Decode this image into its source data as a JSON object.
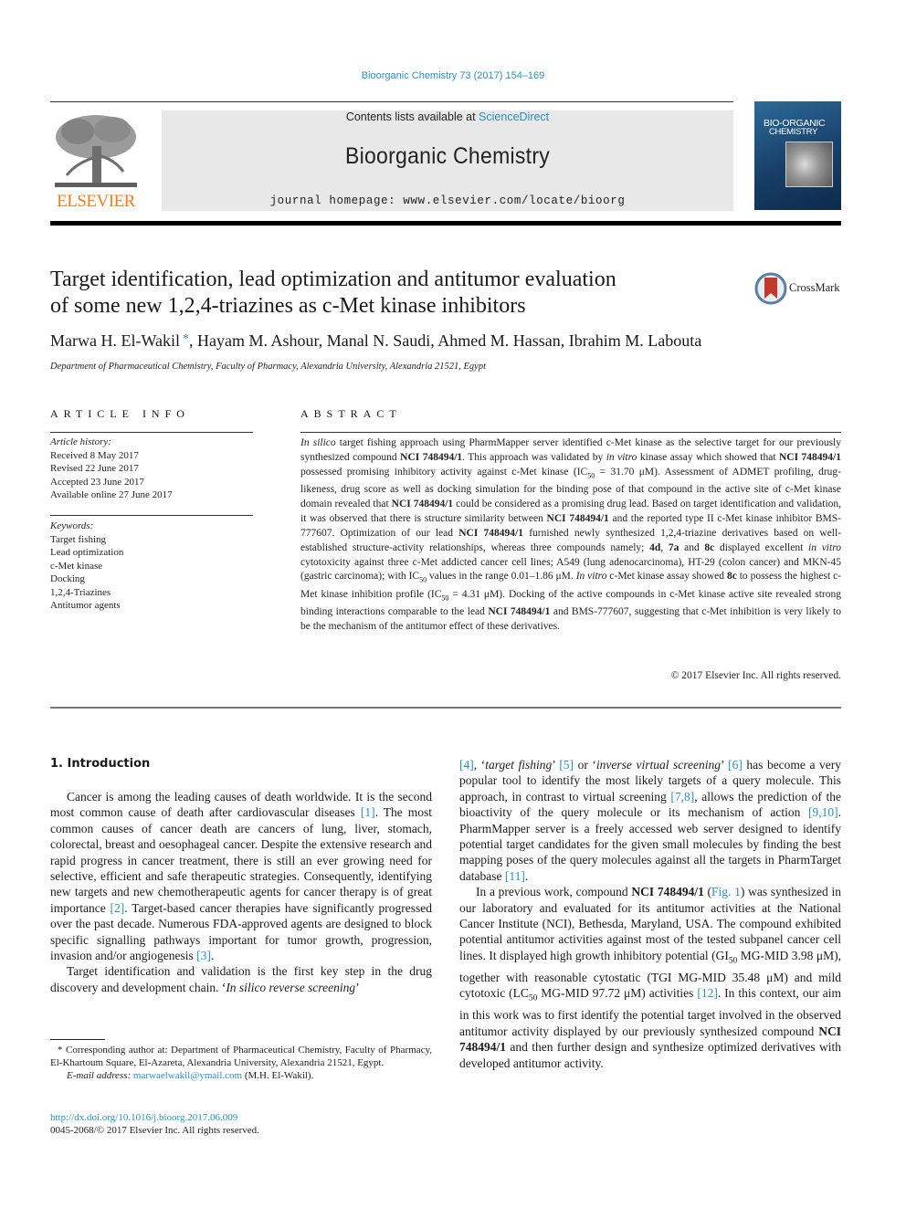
{
  "citation": "Bioorganic Chemistry 73 (2017) 154–169",
  "banner": {
    "contents_prefix": "Contents lists available at ",
    "contents_link": "ScienceDirect",
    "journal_title": "Bioorganic Chemistry",
    "homepage": "journal homepage: www.elsevier.com/locate/bioorg"
  },
  "publisher_logo": {
    "icon": "elsevier-tree-icon",
    "label": "ELSEVIER",
    "color": "#f07d1a"
  },
  "cover": {
    "title_line1": "BIO-ORGANIC",
    "title_line2": "CHEMISTRY"
  },
  "crossmark": {
    "icon": "crossmark-icon",
    "label": "CrossMark"
  },
  "article": {
    "title_line1": "Target identification, lead optimization and antitumor evaluation",
    "title_line2": "of some new 1,2,4-triazines as c-Met kinase inhibitors",
    "authors": [
      {
        "name": "Marwa H. El-Wakil",
        "mark": "*"
      },
      {
        "name": "Hayam M. Ashour"
      },
      {
        "name": "Manal N. Saudi"
      },
      {
        "name": "Ahmed M. Hassan"
      },
      {
        "name": "Ibrahim M. Labouta"
      }
    ],
    "affiliation": "Department of Pharmaceutical Chemistry, Faculty of Pharmacy, Alexandria University, Alexandria 21521, Egypt"
  },
  "article_info": {
    "heading": "ARTICLE INFO",
    "history_label": "Article history:",
    "history": [
      "Received 8 May 2017",
      "Revised 22 June 2017",
      "Accepted 23 June 2017",
      "Available online 27 June 2017"
    ],
    "keywords_label": "Keywords:",
    "keywords": [
      "Target fishing",
      "Lead optimization",
      "c-Met kinase",
      "Docking",
      "1,2,4-Triazines",
      "Antitumor agents"
    ]
  },
  "abstract": {
    "heading": "ABSTRACT",
    "copyright": "© 2017 Elsevier Inc. All rights reserved.",
    "segments": [
      {
        "t": "In silico",
        "s": "i"
      },
      {
        "t": " target fishing approach using PharmMapper server identified c-Met kinase as the selective target for our previously synthesized compound "
      },
      {
        "t": "NCI 748494/1",
        "s": "b"
      },
      {
        "t": ". This approach was validated by "
      },
      {
        "t": "in vitro",
        "s": "i"
      },
      {
        "t": " kinase assay which showed that "
      },
      {
        "t": "NCI 748494/1",
        "s": "b"
      },
      {
        "t": " possessed promising inhibitory activity against c-Met kinase (IC"
      },
      {
        "t": "50",
        "s": "sub"
      },
      {
        "t": " = 31.70 μM). Assessment of ADMET profiling, drug-likeness, drug score as well as docking simulation for the binding pose of that compound in the active site of c-Met kinase domain revealed that "
      },
      {
        "t": "NCI 748494/1",
        "s": "b"
      },
      {
        "t": " could be considered as a promising drug lead. Based on target identification and validation, it was observed that there is structure similarity between "
      },
      {
        "t": "NCI 748494/1",
        "s": "b"
      },
      {
        "t": " and the reported type II c-Met kinase inhibitor BMS-777607. Optimization of our lead "
      },
      {
        "t": "NCI 748494/1",
        "s": "b"
      },
      {
        "t": " furnished newly synthesized 1,2,4-triazine derivatives based on well-established structure-activity relationships, whereas three compounds namely; "
      },
      {
        "t": "4d",
        "s": "b"
      },
      {
        "t": ", "
      },
      {
        "t": "7a",
        "s": "b"
      },
      {
        "t": " and "
      },
      {
        "t": "8c",
        "s": "b"
      },
      {
        "t": " displayed excellent "
      },
      {
        "t": "in vitro",
        "s": "i"
      },
      {
        "t": " cytotoxicity against three c-Met addicted cancer cell lines; A549 (lung adenocarcinoma), HT-29 (colon cancer) and MKN-45 (gastric carcinoma); with IC"
      },
      {
        "t": "50",
        "s": "sub"
      },
      {
        "t": " values in the range 0.01–1.86 μM. "
      },
      {
        "t": "In vitro",
        "s": "i"
      },
      {
        "t": " c-Met kinase assay showed "
      },
      {
        "t": "8c",
        "s": "b"
      },
      {
        "t": " to possess the highest c-Met kinase inhibition profile (IC"
      },
      {
        "t": "50",
        "s": "sub"
      },
      {
        "t": " = 4.31 μM). Docking of the active compounds in c-Met kinase active site revealed strong binding interactions comparable to the lead "
      },
      {
        "t": "NCI 748494/1",
        "s": "b"
      },
      {
        "t": " and BMS-777607, suggesting that c-Met inhibition is very likely to be the mechanism of the antitumor effect of these derivatives."
      }
    ]
  },
  "introduction": {
    "heading": "1. Introduction",
    "left_paragraphs": [
      [
        {
          "t": "Cancer is among the leading causes of death worldwide. It is the second most common cause of death after cardiovascular diseases "
        },
        {
          "t": "[1]",
          "s": "link"
        },
        {
          "t": ". The most common causes of cancer death are cancers of lung, liver, stomach, colorectal, breast and oesophageal cancer. Despite the extensive research and rapid progress in cancer treatment, there is still an ever growing need for selective, efficient and safe therapeutic strategies. Consequently, identifying new targets and new chemotherapeutic agents for cancer therapy is of great importance "
        },
        {
          "t": "[2]",
          "s": "link"
        },
        {
          "t": ". Target-based cancer therapies have significantly progressed over the past decade. Numerous FDA-approved agents are designed to block specific signalling pathways important for tumor growth, progression, invasion and/or angiogenesis "
        },
        {
          "t": "[3]",
          "s": "link"
        },
        {
          "t": "."
        }
      ],
      [
        {
          "t": "Target identification and validation is the first key step in the drug discovery and development chain. ‘"
        },
        {
          "t": "In silico reverse screening",
          "s": "i"
        },
        {
          "t": "’"
        }
      ]
    ],
    "right_paragraphs": [
      [
        {
          "t": "[4]",
          "s": "link"
        },
        {
          "t": ", ‘"
        },
        {
          "t": "target fishing",
          "s": "i"
        },
        {
          "t": "’ "
        },
        {
          "t": "[5]",
          "s": "link"
        },
        {
          "t": " or ‘"
        },
        {
          "t": "inverse virtual screening",
          "s": "i"
        },
        {
          "t": "’ "
        },
        {
          "t": "[6]",
          "s": "link"
        },
        {
          "t": " has become a very popular tool to identify the most likely targets of a query molecule. This approach, in contrast to virtual screening "
        },
        {
          "t": "[7,8]",
          "s": "link"
        },
        {
          "t": ", allows the prediction of the bioactivity of the query molecule or its mechanism of action "
        },
        {
          "t": "[9,10]",
          "s": "link"
        },
        {
          "t": ". PharmMapper server is a freely accessed web server designed to identify potential target candidates for the given small molecules by finding the best mapping poses of the query molecules against all the targets in PharmTarget database "
        },
        {
          "t": "[11]",
          "s": "link"
        },
        {
          "t": "."
        }
      ],
      [
        {
          "t": "In a previous work, compound "
        },
        {
          "t": "NCI 748494/1",
          "s": "b"
        },
        {
          "t": " ("
        },
        {
          "t": "Fig. 1",
          "s": "link"
        },
        {
          "t": ") was synthesized in our laboratory and evaluated for its antitumor activities at the National Cancer Institute (NCI), Bethesda, Maryland, USA. The compound exhibited potential antitumor activities against most of the tested subpanel cancer cell lines. It displayed high growth inhibitory potential (GI"
        },
        {
          "t": "50",
          "s": "sub"
        },
        {
          "t": " MG-MID 3.98 μM), together with reasonable cytostatic (TGI MG-MID 35.48 μM) and mild cytotoxic (LC"
        },
        {
          "t": "50",
          "s": "sub"
        },
        {
          "t": " MG-MID 97.72 μM) activities "
        },
        {
          "t": "[12]",
          "s": "link"
        },
        {
          "t": ". In this context, our aim in this work was to first identify the potential target involved in the observed antitumor activity displayed by our previously synthesized compound "
        },
        {
          "t": "NCI 748494/1",
          "s": "b"
        },
        {
          "t": " and then further design and synthesize optimized derivatives with developed antitumor activity."
        }
      ]
    ]
  },
  "footnote": {
    "mark": "*",
    "text": "Corresponding author at: Department of Pharmaceutical Chemistry, Faculty of Pharmacy, El-Khartoum Square, El-Azareta, Alexandria University, Alexandria 21521, Egypt.",
    "email_label": "E-mail address:",
    "email": "marwaelwakil@ymail.com",
    "email_suffix": " (M.H. El-Wakil)."
  },
  "doi": {
    "link": "http://dx.doi.org/10.1016/j.bioorg.2017.06.009",
    "issn_line": "0045-2068/© 2017 Elsevier Inc. All rights reserved."
  }
}
